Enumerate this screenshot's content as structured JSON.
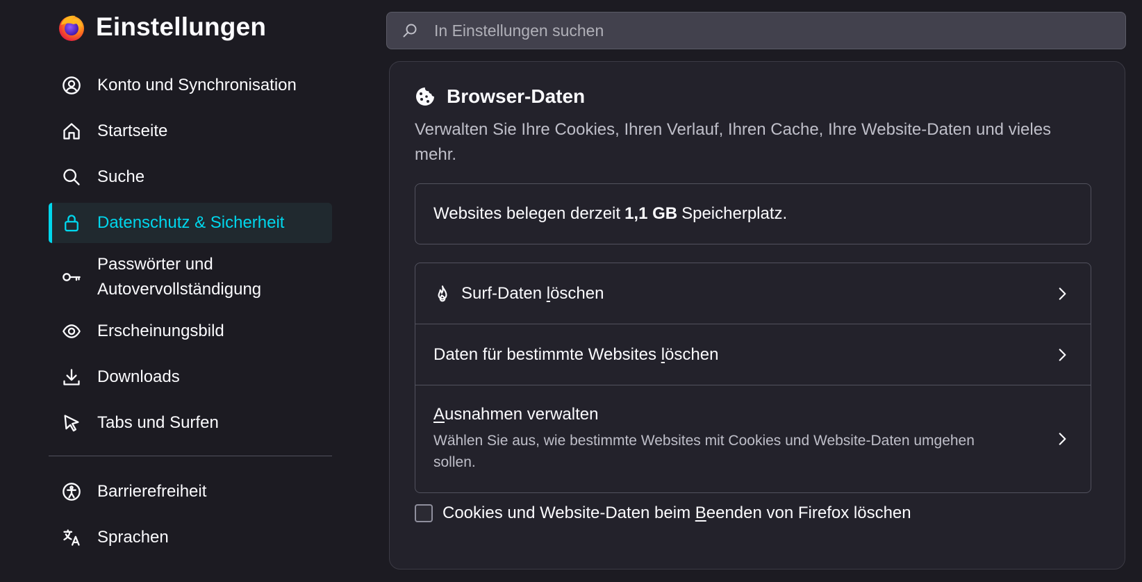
{
  "app": {
    "title": "Einstellungen"
  },
  "search": {
    "placeholder": "In Einstellungen suchen",
    "value": ""
  },
  "sidebar": {
    "items": [
      {
        "label": "Konto und Synchronisation",
        "icon": "account-icon"
      },
      {
        "label": "Startseite",
        "icon": "home-icon"
      },
      {
        "label": "Suche",
        "icon": "search-icon"
      },
      {
        "label": "Datenschutz & Sicherheit",
        "icon": "lock-icon",
        "active": true
      },
      {
        "label_line1": "Passwörter und",
        "label_line2": "Autovervollständigung",
        "icon": "key-icon"
      },
      {
        "label": "Erscheinungsbild",
        "icon": "eye-icon"
      },
      {
        "label": "Downloads",
        "icon": "download-icon"
      },
      {
        "label": "Tabs und Surfen",
        "icon": "pointer-icon"
      }
    ],
    "extra_items": [
      {
        "label": "Barrierefreiheit",
        "icon": "accessibility-icon"
      },
      {
        "label": "Sprachen",
        "icon": "translate-icon"
      }
    ]
  },
  "section": {
    "title": "Browser-Daten",
    "description": "Verwalten Sie Ihre Cookies, Ihren Verlauf, Ihren Cache, Ihre Website-Daten und vieles mehr.",
    "storage": {
      "prefix": "Websites belegen derzeit",
      "amount": "1,1 GB",
      "suffix": "Speicherplatz."
    },
    "actions": {
      "clear_browsing": {
        "before": "Surf-Daten ",
        "key": "l",
        "after": "öschen"
      },
      "clear_site": {
        "before": "Daten für bestimmte Websites ",
        "key": "l",
        "after": "öschen"
      },
      "exceptions": {
        "key": "A",
        "after": "usnahmen verwalten",
        "description": "Wählen Sie aus, wie bestimmte Websites mit Cookies und Website-Daten umgehen sollen."
      }
    },
    "checkbox": {
      "before": "Cookies und Website-Daten beim ",
      "key": "B",
      "after": "eenden von Firefox löschen",
      "checked": false
    }
  },
  "colors": {
    "background": "#1c1b22",
    "card": "#23222b",
    "accent": "#00d6ec",
    "text": "#fbfbfe",
    "muted_text": "#bfbfc9",
    "border": "#52525e"
  }
}
